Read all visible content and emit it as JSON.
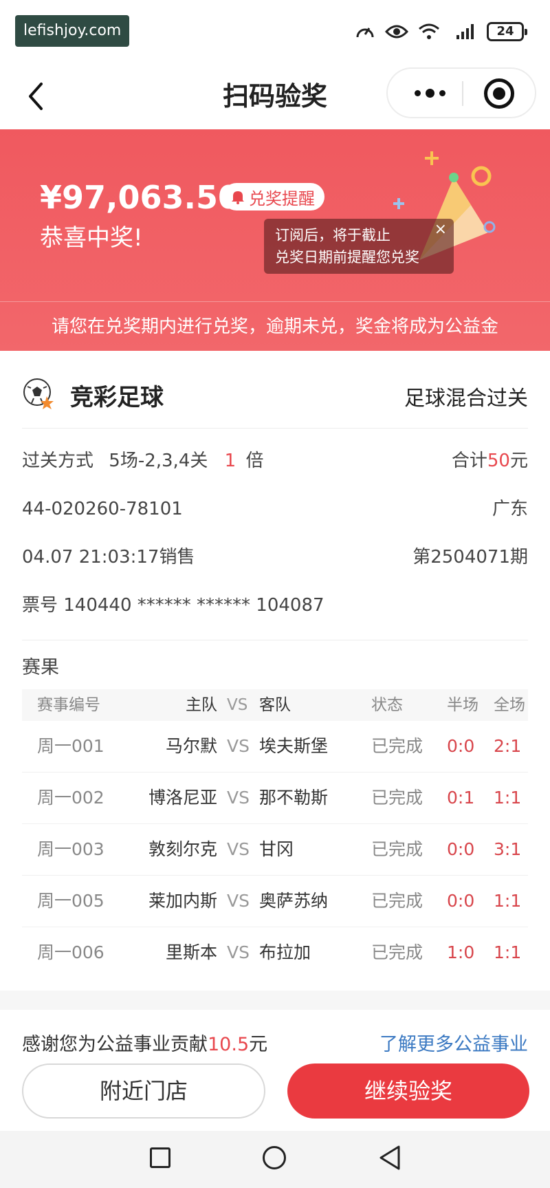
{
  "status_bar": {
    "watermark": "lefishjoy.com",
    "battery": "24"
  },
  "nav": {
    "title": "扫码验奖"
  },
  "banner": {
    "amount": "¥97,063.50",
    "remind_label": "兑奖提醒",
    "congrats": "恭喜中奖!",
    "tooltip_line1": "订阅后，将于截止",
    "tooltip_line2": "兑奖日期前提醒您兑奖",
    "tooltip_close": "×",
    "note": "请您在兑奖期内进行兑奖，逾期未兑，奖金将成为公益金"
  },
  "ticket": {
    "game_name": "竞彩足球",
    "game_type": "足球混合过关",
    "pass_label": "过关方式",
    "pass_value": "5场-2,3,4关",
    "multiple_num": "1",
    "multiple_unit": "倍",
    "total_label": "合计",
    "total_value": "50",
    "total_unit": "元",
    "serial": "44-020260-78101",
    "province": "广东",
    "sale_time": "04.07 21:03:17销售",
    "issue": "第2504071期",
    "ticket_no": "票号 140440 ****** ****** 104087"
  },
  "results": {
    "title": "赛果",
    "headers": {
      "id": "赛事编号",
      "home": "主队",
      "vs": "VS",
      "away": "客队",
      "state": "状态",
      "half": "半场",
      "full": "全场"
    },
    "rows": [
      {
        "id": "周一001",
        "home": "马尔默",
        "vs": "VS",
        "away": "埃夫斯堡",
        "state": "已完成",
        "half": "0:0",
        "full": "2:1"
      },
      {
        "id": "周一002",
        "home": "博洛尼亚",
        "vs": "VS",
        "away": "那不勒斯",
        "state": "已完成",
        "half": "0:1",
        "full": "1:1"
      },
      {
        "id": "周一003",
        "home": "敦刻尔克",
        "vs": "VS",
        "away": "甘冈",
        "state": "已完成",
        "half": "0:0",
        "full": "3:1"
      },
      {
        "id": "周一005",
        "home": "莱加内斯",
        "vs": "VS",
        "away": "奥萨苏纳",
        "state": "已完成",
        "half": "0:0",
        "full": "1:1"
      },
      {
        "id": "周一006",
        "home": "里斯本",
        "vs": "VS",
        "away": "布拉加",
        "state": "已完成",
        "half": "1:0",
        "full": "1:1"
      }
    ]
  },
  "footer": {
    "thanks_prefix": "感谢您为公益事业贡献",
    "thanks_amount": "10.5",
    "thanks_unit": "元",
    "learn_more": "了解更多公益事业",
    "nearby_store": "附近门店",
    "continue_check": "继续验奖"
  },
  "colors": {
    "accent_red": "#ea3a40",
    "banner_red": "#f0595f",
    "link_blue": "#3b79c2"
  }
}
